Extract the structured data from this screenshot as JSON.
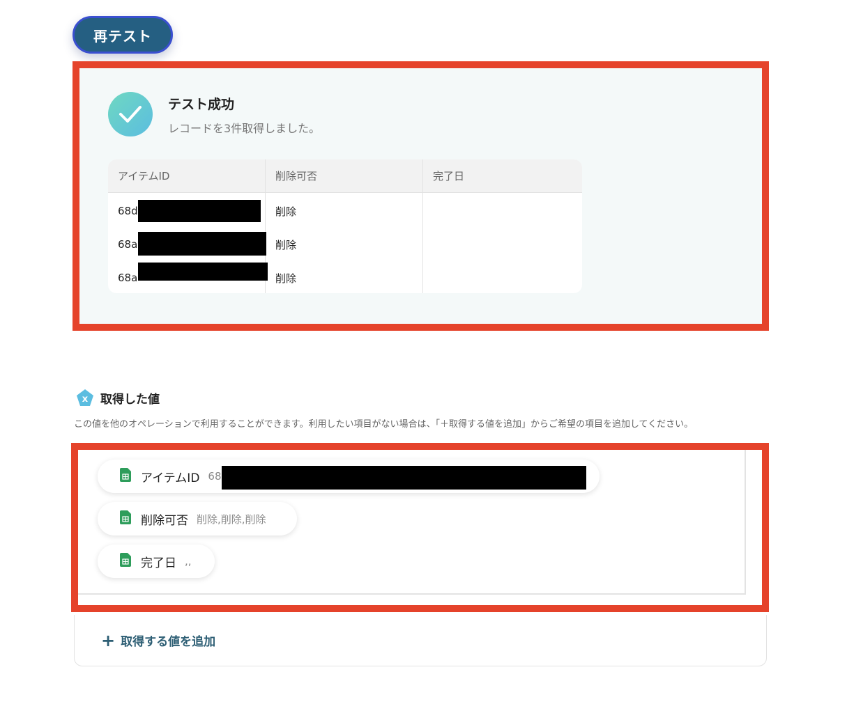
{
  "retest_label": "再テスト",
  "result": {
    "title": "テスト成功",
    "subtitle": "レコードを3件取得しました。",
    "columns": [
      "アイテムID",
      "削除可否",
      "完了日"
    ],
    "rows": [
      {
        "id_prefix": "68d",
        "delete": "削除",
        "done": ""
      },
      {
        "id_prefix": "68a",
        "delete": "削除",
        "done": ""
      },
      {
        "id_prefix": "68a",
        "delete": "削除",
        "done": ""
      }
    ]
  },
  "values_section": {
    "title": "取得した値",
    "description": "この値を他のオペレーションで利用することができます。利用したい項目がない場合は、「＋取得する値を追加」からご希望の項目を追加してください。",
    "chips": [
      {
        "label": "アイテムID",
        "value": "68"
      },
      {
        "label": "削除可否",
        "value": "削除,削除,削除"
      },
      {
        "label": "完了日",
        "value": ",,"
      }
    ],
    "add_label": "取得する値を追加",
    "add_icon": "+"
  },
  "colors": {
    "accent": "#2d5e74",
    "highlight": "#e5432b",
    "success_start": "#6fd8c1",
    "success_end": "#5bbde0",
    "sheet_green": "#2e9d5b"
  }
}
